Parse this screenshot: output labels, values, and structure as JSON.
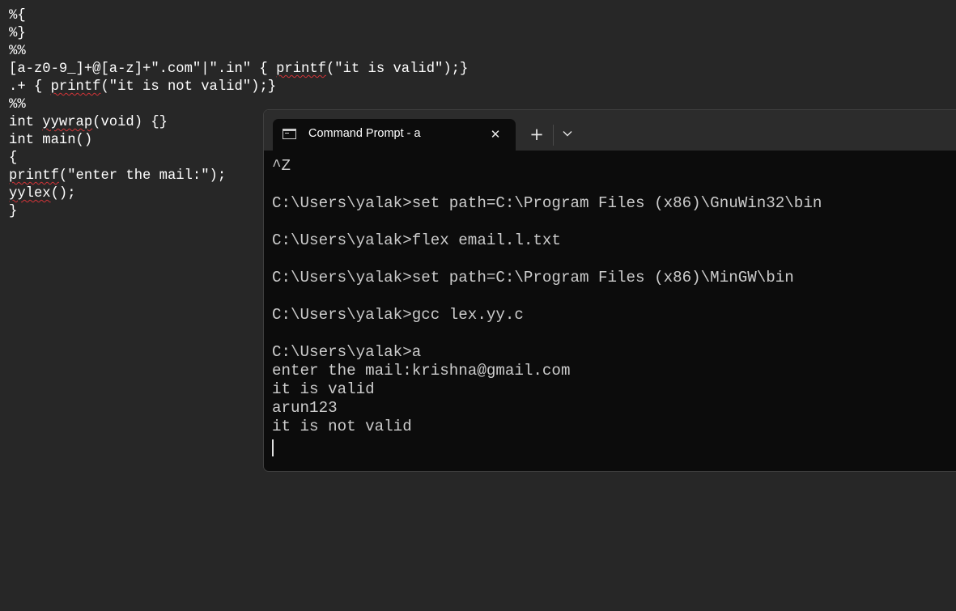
{
  "editor": {
    "lines": [
      {
        "parts": [
          {
            "text": "%{",
            "err": false
          }
        ]
      },
      {
        "parts": [
          {
            "text": "%}",
            "err": false
          }
        ]
      },
      {
        "parts": [
          {
            "text": "%%",
            "err": false
          }
        ]
      },
      {
        "parts": [
          {
            "text": "[a-z0-9_]+@[a-z]+\".com\"|\".in\" { ",
            "err": false
          },
          {
            "text": "printf",
            "err": true
          },
          {
            "text": "(\"it is valid\");}",
            "err": false
          }
        ]
      },
      {
        "parts": [
          {
            "text": ".+ { ",
            "err": false
          },
          {
            "text": "printf",
            "err": true
          },
          {
            "text": "(\"it is not valid\");}",
            "err": false
          }
        ]
      },
      {
        "parts": [
          {
            "text": "%%",
            "err": false
          }
        ]
      },
      {
        "parts": [
          {
            "text": "int ",
            "err": false
          },
          {
            "text": "yywrap",
            "err": true
          },
          {
            "text": "(void) {}",
            "err": false
          }
        ]
      },
      {
        "parts": [
          {
            "text": "int main()",
            "err": false
          }
        ]
      },
      {
        "parts": [
          {
            "text": "{",
            "err": false
          }
        ]
      },
      {
        "parts": [
          {
            "text": "printf",
            "err": true
          },
          {
            "text": "(\"enter the mail:\");",
            "err": false
          }
        ]
      },
      {
        "parts": [
          {
            "text": "yylex",
            "err": true
          },
          {
            "text": "();",
            "err": false
          }
        ]
      },
      {
        "parts": [
          {
            "text": "}",
            "err": false
          }
        ]
      }
    ]
  },
  "terminal": {
    "tab_title": "Command Prompt - a",
    "tab_icon": "command-prompt-icon",
    "close_glyph": "✕",
    "new_tab_glyph": "+",
    "output": [
      "^Z",
      "",
      "C:\\Users\\yalak>set path=C:\\Program Files (x86)\\GnuWin32\\bin",
      "",
      "C:\\Users\\yalak>flex email.l.txt",
      "",
      "C:\\Users\\yalak>set path=C:\\Program Files (x86)\\MinGW\\bin",
      "",
      "C:\\Users\\yalak>gcc lex.yy.c",
      "",
      "C:\\Users\\yalak>a",
      "enter the mail:krishna@gmail.com",
      "it is valid",
      "arun123",
      "it is not valid"
    ]
  },
  "colors": {
    "desktop_bg": "#272727",
    "terminal_bg": "#0c0c0c",
    "tabbar_bg": "#2c2c2c",
    "terminal_text": "#cccccc",
    "editor_text": "#ffffff",
    "spell_error": "#d13438"
  }
}
